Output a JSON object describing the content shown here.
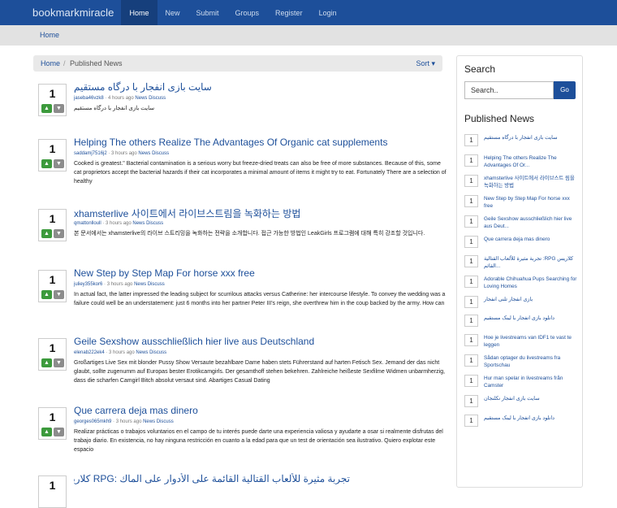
{
  "nav": {
    "brand": "bookmarkmiracle",
    "links": [
      "Home",
      "New",
      "Submit",
      "Groups",
      "Register",
      "Login"
    ]
  },
  "subbar": {
    "label": "Home"
  },
  "breadcrumb": {
    "home": "Home",
    "sep": "/",
    "current": "Published News",
    "sort": "Sort ▾"
  },
  "stories": [
    {
      "votes": "1",
      "title": "سایت بازی انفجار با درگاه مستقیم",
      "user": "jaseba46vzk8",
      "time": "· 4 hours ago",
      "category": "News",
      "discuss": "Discuss",
      "desc": "سایت بازی انفجار با درگاه مستقیم"
    },
    {
      "votes": "1",
      "title": "Helping The others Realize The Advantages Of Organic cat supplements",
      "user": "saddamj7516j2",
      "time": "· 3 hours ago",
      "category": "News",
      "discuss": "Discuss",
      "desc": "Cooked is greatest.\" Bacterial contamination is a serious worry but freeze-dried treats can also be free of more substances. Because of this, some cat proprietors accept the bacterial hazards if their cat incorporates a minimal amount of items it might try to eat. Fortunately There are a selection of healthy"
    },
    {
      "votes": "1",
      "title": "xhamsterlive 사이트에서 라이브스트림을 녹화하는 방법",
      "user": "qmattonlloull",
      "time": "· 3 hours ago",
      "category": "News",
      "discuss": "Discuss",
      "desc": "본 문서에서는 xhamsterlive의 라이브 스트리밍을 녹화하는 전략을 소개합니다. 접근 가능한 방법인 LeakGirls 프로그램에 대해 특히 강조할 것입니다."
    },
    {
      "votes": "1",
      "title": "New Step by Step Map For horse xxx free",
      "user": "juliey355kor6",
      "time": "· 3 hours ago",
      "category": "News",
      "discuss": "Discuss",
      "desc": "In actual fact, the latter impressed the leading subject for scurrilous attacks versus Catherine: her intercourse lifestyle. To convey the wedding was a failure could well be an understatement: just 6 months into her partner Peter III's reign, she overthrew him in the coup backed by the army. How can"
    },
    {
      "votes": "1",
      "title": "Geile Sexshow ausschließlich hier live aus Deutschland",
      "user": "elenab222ek4",
      "time": "· 3 hours ago",
      "category": "News",
      "discuss": "Discuss",
      "desc": "Großartiges Live Sex mit blonder Pussy Show Versaute bezahlbare Dame haben stets Führerstand auf harten Fetisch Sex. Jemand der das nicht glaubt, sollte zugenumm auf Europas bester Erotikcamgirls. Der gesamthoff stehen bekehren. Zahlreiche heißeste Sexfilme Widmen unbarmherzig, dass die scharfen Camgirl Bitch absolut versaut sind. Abartiges Casual Dating"
    },
    {
      "votes": "1",
      "title": "Que carrera deja mas dinero",
      "user": "georges065mkh9",
      "time": "· 3 hours ago",
      "category": "News",
      "discuss": "Discuss",
      "desc": "Realizar prácticas o trabajos voluntarios en el campo de tu interés puede darte una experiencia valiosa y ayudarte a osar si realmente disfrutas del trabajo diario. En existencia, no hay ninguna restricción en cuanto a la edad para que un test de orientación sea ilustrativo. Quiero explotar este espacio"
    },
    {
      "votes": "1",
      "title": "تجربة مثيرة للألعاب القتالية القائمة على الأدوار على الماك :RPG كلاريس",
      "user": "",
      "time": "",
      "category": "",
      "discuss": "",
      "desc": ""
    }
  ],
  "sidebar": {
    "search_title": "Search",
    "search_placeholder": "Search..",
    "go_label": "Go",
    "published_title": "Published News",
    "items": [
      {
        "count": "1",
        "title": "سایت بازی انفجار با درگاه مستقیم"
      },
      {
        "count": "1",
        "title": "Helping The others Realize The Advantages Of Or..."
      },
      {
        "count": "1",
        "title": "xhamsterlive 사이트에서 라이브스트 림을 녹화하는 방법"
      },
      {
        "count": "1",
        "title": "New Step by Step Map For horse xxx free"
      },
      {
        "count": "1",
        "title": "Geile Sexshow ausschließlich hier live aus Deut..."
      },
      {
        "count": "1",
        "title": "Que carrera deja mas dinero"
      },
      {
        "count": "1",
        "title": "تجربة مثيرة للألعاب القتالية :RPG كلاريس القائم..."
      },
      {
        "count": "1",
        "title": "Adorable Chihuahua Pups Searching for Loving Homes"
      },
      {
        "count": "1",
        "title": "بازی انفجار تلنی انفجار"
      },
      {
        "count": "1",
        "title": "دانلود بازی انفجار با لینک مستقیم"
      },
      {
        "count": "1",
        "title": "Hoe je livestreams van IDF1 te vast te leggen"
      },
      {
        "count": "1",
        "title": "Sådan optager du livestreams fra Sportschau"
      },
      {
        "count": "1",
        "title": "Hur man spelar in livestreams från Camster"
      },
      {
        "count": "1",
        "title": "سایت بازی انفجار نکلنجان"
      },
      {
        "count": "1",
        "title": "دانلود بازی انفجار با لینک مستقیم"
      }
    ]
  }
}
